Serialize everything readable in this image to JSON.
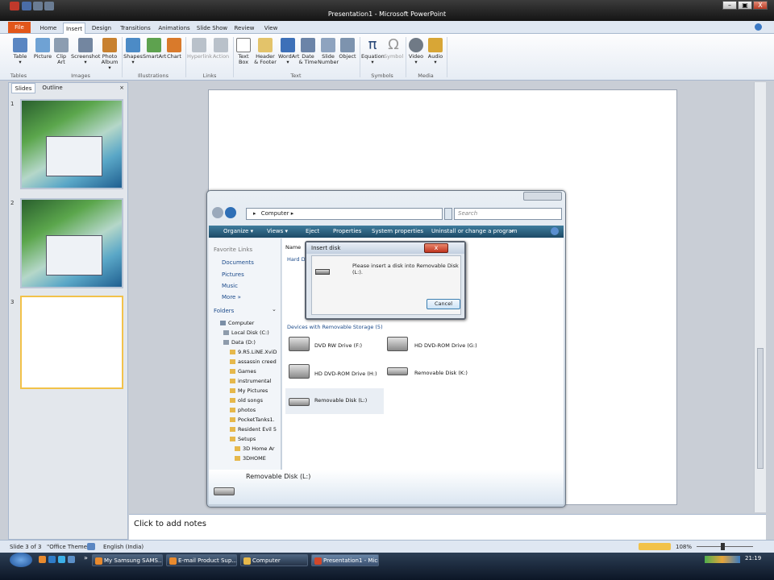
{
  "window": {
    "title": "Presentation1 - Microsoft PowerPoint",
    "min": "–",
    "max": "▣",
    "close": "X"
  },
  "ribbon_tabs": [
    "File",
    "Home",
    "Insert",
    "Design",
    "Transitions",
    "Animations",
    "Slide Show",
    "Review",
    "View"
  ],
  "ribbon": {
    "buttons": [
      {
        "l1": "Table",
        "l2": "▾"
      },
      {
        "l1": "Picture",
        "l2": ""
      },
      {
        "l1": "Clip",
        "l2": "Art"
      },
      {
        "l1": "Screenshot",
        "l2": "▾"
      },
      {
        "l1": "Photo",
        "l2": "Album ▾"
      },
      {
        "l1": "Shapes",
        "l2": "▾"
      },
      {
        "l1": "SmartArt",
        "l2": ""
      },
      {
        "l1": "Chart",
        "l2": ""
      },
      {
        "l1": "Hyperlink",
        "l2": ""
      },
      {
        "l1": "Action",
        "l2": ""
      },
      {
        "l1": "Text",
        "l2": "Box"
      },
      {
        "l1": "Header",
        "l2": "& Footer"
      },
      {
        "l1": "WordArt",
        "l2": "▾"
      },
      {
        "l1": "Date",
        "l2": "& Time"
      },
      {
        "l1": "Slide",
        "l2": "Number"
      },
      {
        "l1": "Object",
        "l2": ""
      },
      {
        "l1": "Equation",
        "l2": "▾"
      },
      {
        "l1": "Symbol",
        "l2": ""
      },
      {
        "l1": "Video",
        "l2": "▾"
      },
      {
        "l1": "Audio",
        "l2": "▾"
      }
    ],
    "groups": [
      "Tables",
      "Images",
      "Illustrations",
      "Links",
      "Text",
      "Symbols",
      "Media"
    ]
  },
  "pane": {
    "tab_slides": "Slides",
    "tab_outline": "Outline",
    "close": "×",
    "slide_numbers": [
      "1",
      "2",
      "3"
    ]
  },
  "notes_placeholder": "Click to add notes",
  "status": {
    "slide": "Slide 3 of 3",
    "theme": "\"Office Theme\"",
    "language": "English (India)",
    "zoom": "108%"
  },
  "taskbar": {
    "items": [
      "My Samsung SAMS...",
      "E-mail Product Sup...",
      "Computer",
      "Presentation1 - Micr..."
    ],
    "more": "»",
    "clock": "21:19"
  },
  "explorer": {
    "address": "Computer ▸",
    "address_prefix": "▸",
    "search_placeholder": "Search",
    "commands": [
      "Organize ▾",
      "Views ▾",
      "Eject",
      "Properties",
      "System properties",
      "Uninstall or change a program",
      "»"
    ],
    "favorite_links_heading": "Favorite Links",
    "favorites": [
      "Documents",
      "Pictures",
      "Music",
      "More »"
    ],
    "folders_heading": "Folders",
    "folders_chevron": "⌄",
    "tree": [
      "Computer",
      "Local Disk (C:)",
      "Data (D:)",
      "9.R5.LiNE.XviD",
      "assassin creed",
      "Games",
      "instrumental",
      "My Pictures",
      "old songs",
      "photos",
      "PocketTanks1.",
      "Resident Evil 5",
      "Setups",
      "3D Home Ar",
      "3DHOME"
    ],
    "column_name": "Name",
    "hard_disk_heading": "Hard Di",
    "removable_heading": "Devices with Removable Storage (5)",
    "drives": [
      "DVD RW Drive (F:)",
      "HD DVD-ROM Drive (G:)",
      "HD DVD-ROM Drive (H:)",
      "Removable Disk (K:)",
      "Removable Disk (L:)"
    ],
    "details_name": "Removable Disk (L:)"
  },
  "dialog": {
    "title": "Insert disk",
    "message": "Please insert a disk into Removable Disk (L:).",
    "button": "Cancel",
    "close": "x"
  },
  "colors": {
    "file_tab": "#e2561a",
    "selected_thumb": "#f2c24a",
    "explorer_cmdbar": "#1d4a66"
  }
}
